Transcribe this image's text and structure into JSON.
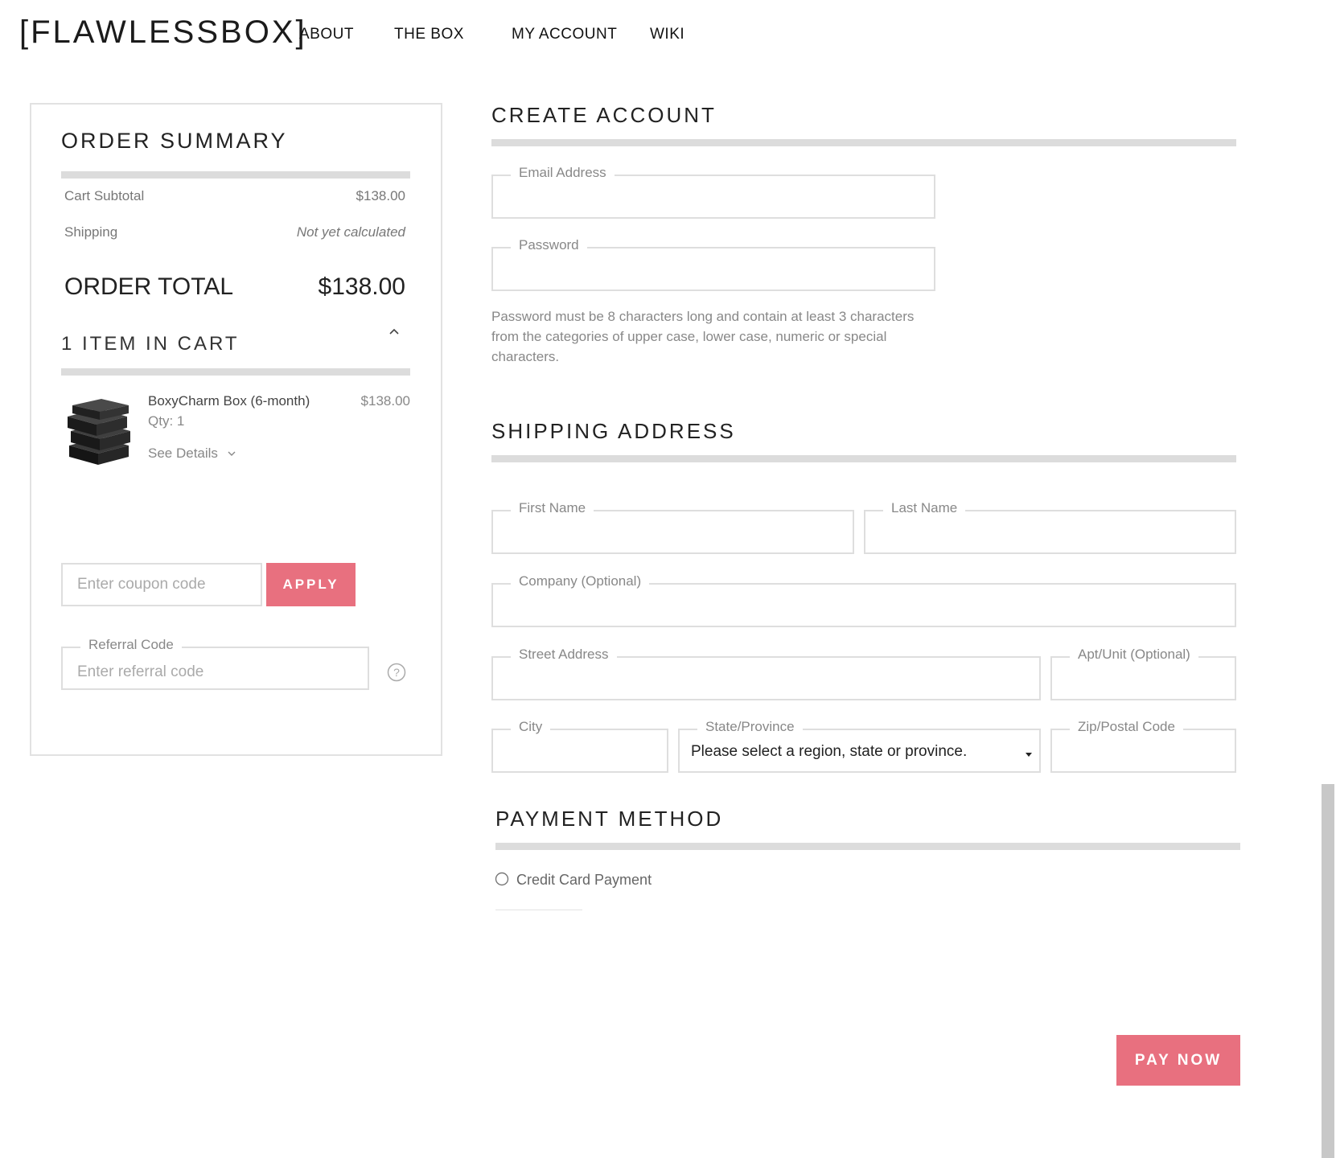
{
  "brand": {
    "logo_text": "FLAWLESSBOX"
  },
  "nav": {
    "about": "ABOUT",
    "the_box": "THE BOX",
    "my_account": "MY ACCOUNT",
    "wiki": "WIKI"
  },
  "summary": {
    "title": "ORDER SUMMARY",
    "subtotal_label": "Cart Subtotal",
    "subtotal_value": "$138.00",
    "shipping_label": "Shipping",
    "shipping_value": "Not yet calculated",
    "total_label": "ORDER TOTAL",
    "total_value": "$138.00",
    "items_heading": "1 ITEM IN CART",
    "item": {
      "name": "BoxyCharm Box (6-month)",
      "qty": "Qty: 1",
      "price": "$138.00",
      "details_label": "See Details"
    },
    "coupon_placeholder": "Enter coupon code",
    "apply_label": "APPLY",
    "referral_legend": "Referral Code",
    "referral_placeholder": "Enter referral code"
  },
  "create_account": {
    "title": "CREATE ACCOUNT",
    "email_legend": "Email Address",
    "password_legend": "Password",
    "password_help": "Password must be 8 characters long and contain at least 3 characters from the categories of upper case, lower case, numeric or special characters."
  },
  "shipping": {
    "title": "SHIPPING ADDRESS",
    "first_name": "First Name",
    "last_name": "Last Name",
    "company": "Company (Optional)",
    "street": "Street Address",
    "apt": "Apt/Unit (Optional)",
    "city": "City",
    "state_legend": "State/Province",
    "state_selected": "Please select a region, state or province.",
    "zip": "Zip/Postal Code"
  },
  "payment": {
    "title": "PAYMENT METHOD",
    "credit_card": "Credit Card Payment",
    "pay_now": "PAY NOW"
  }
}
